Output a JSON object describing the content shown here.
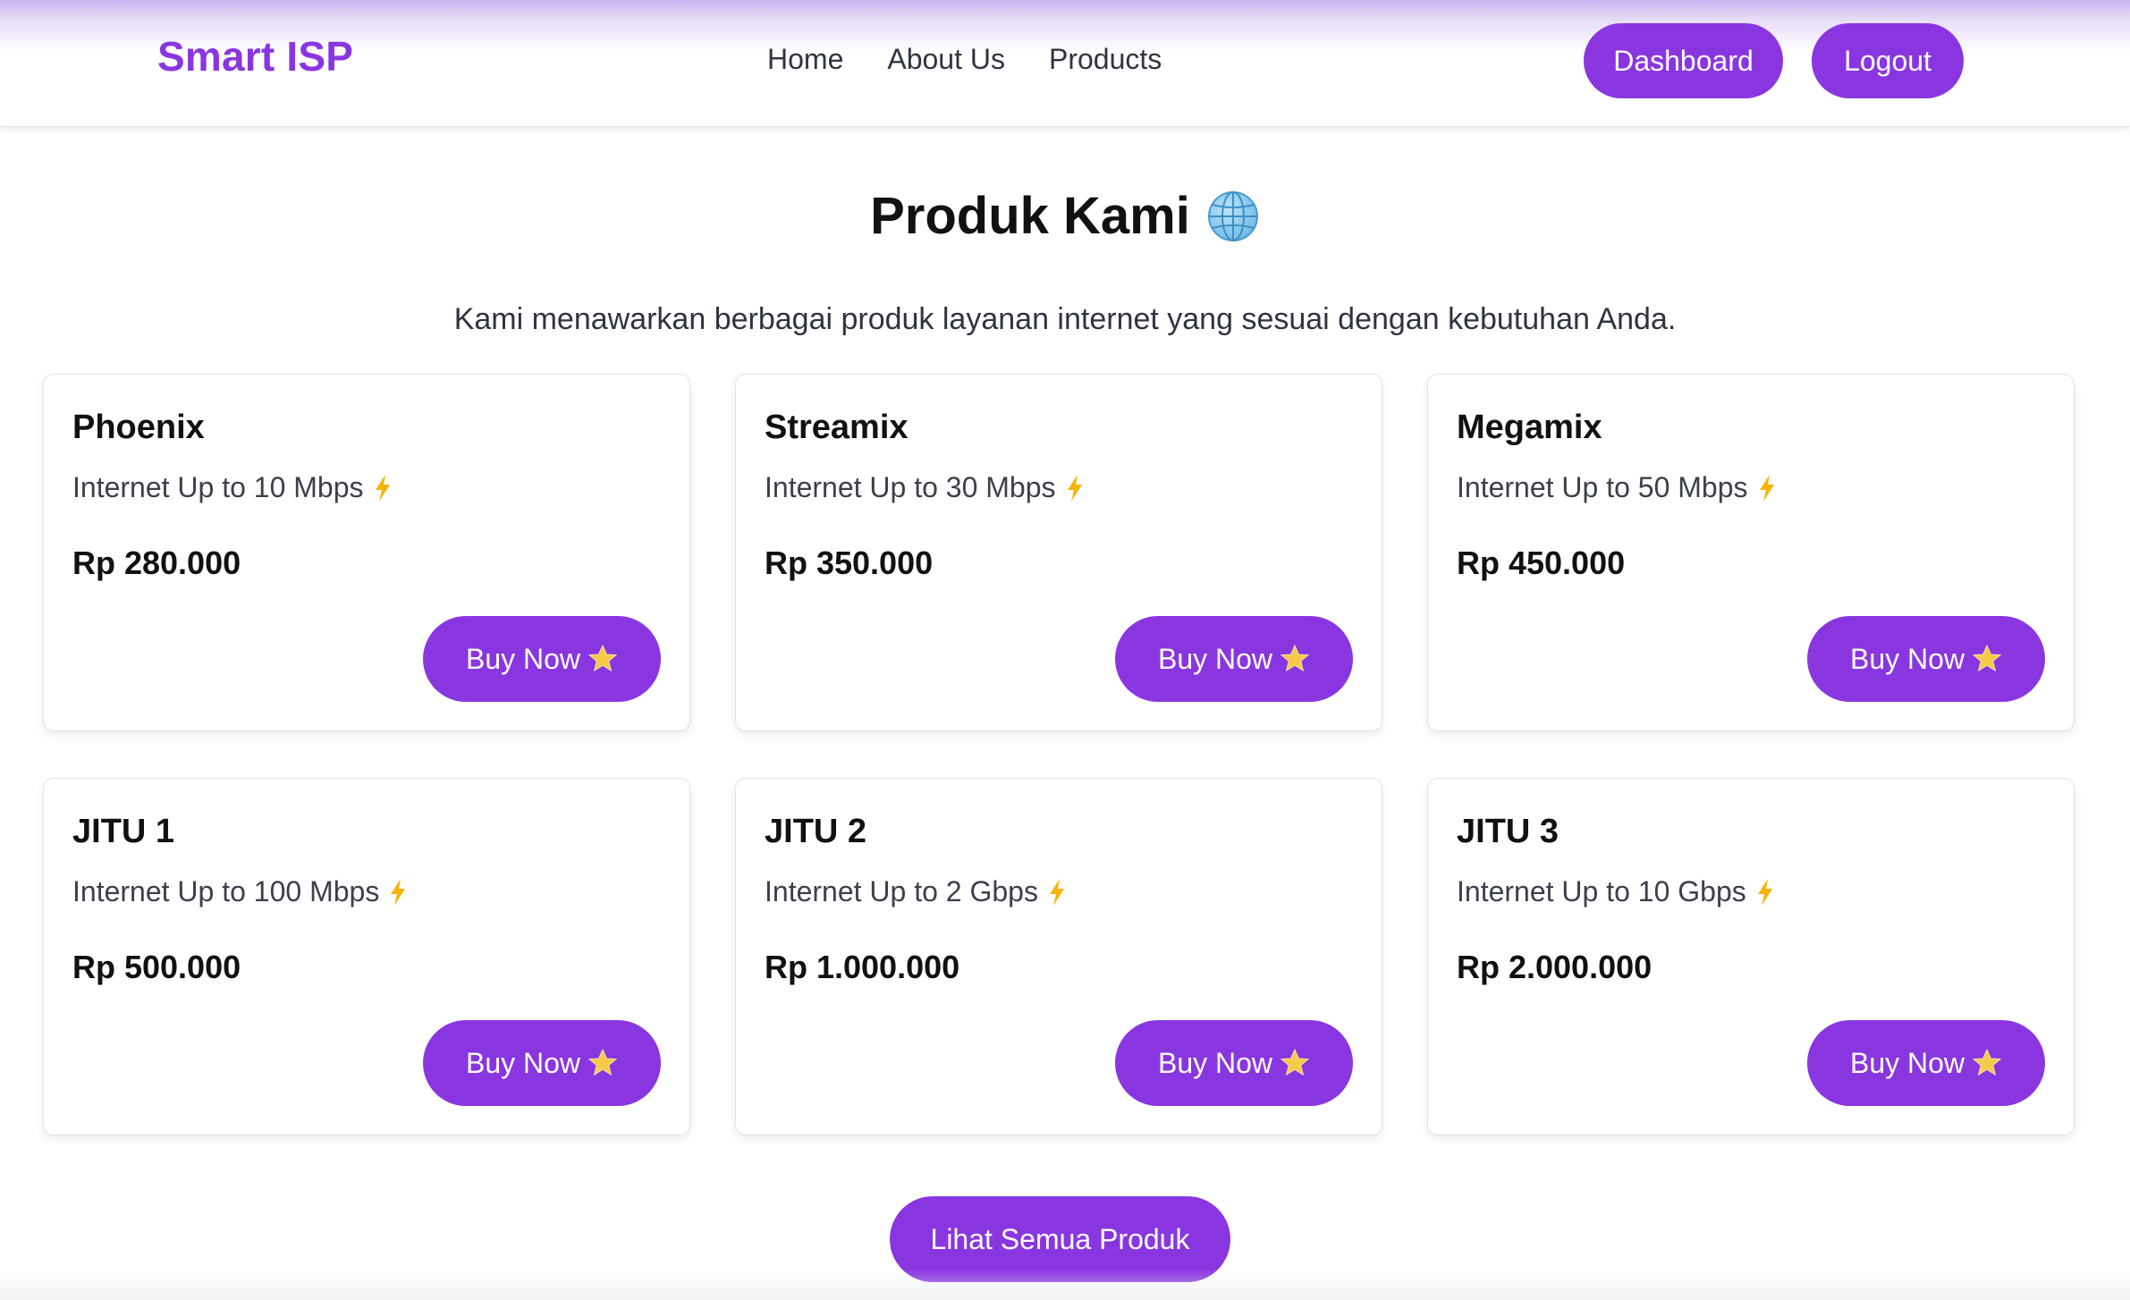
{
  "header": {
    "brand": "Smart ISP",
    "nav": [
      "Home",
      "About Us",
      "Products"
    ],
    "dashboard_label": "Dashboard",
    "logout_label": "Logout"
  },
  "section": {
    "title": "Produk Kami",
    "title_icon": "globe-icon",
    "subtitle": "Kami menawarkan berbagai produk layanan internet yang sesuai dengan kebutuhan Anda."
  },
  "products": [
    {
      "name": "Phoenix",
      "speed": "Internet Up to 10 Mbps",
      "price": "Rp 280.000",
      "button": "Buy Now"
    },
    {
      "name": "Streamix",
      "speed": "Internet Up to 30 Mbps",
      "price": "Rp 350.000",
      "button": "Buy Now"
    },
    {
      "name": "Megamix",
      "speed": "Internet Up to 50 Mbps",
      "price": "Rp 450.000",
      "button": "Buy Now"
    },
    {
      "name": "JITU 1",
      "speed": "Internet Up to 100 Mbps",
      "price": "Rp 500.000",
      "button": "Buy Now"
    },
    {
      "name": "JITU 2",
      "speed": "Internet Up to 2 Gbps",
      "price": "Rp 1.000.000",
      "button": "Buy Now"
    },
    {
      "name": "JITU 3",
      "speed": "Internet Up to 10 Gbps",
      "price": "Rp 2.000.000",
      "button": "Buy Now"
    }
  ],
  "view_all_label": "Lihat Semua Produk",
  "colors": {
    "accent": "#8a36e0",
    "bolt": "#f5b400",
    "star": "#f7c948"
  }
}
